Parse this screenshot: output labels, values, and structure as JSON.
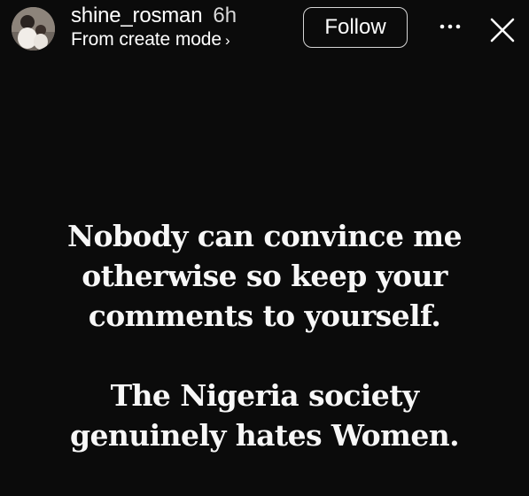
{
  "header": {
    "username": "shine_rosman",
    "time": "6h",
    "subtitle": "From create mode",
    "subtitle_chevron": "›",
    "follow_label": "Follow",
    "avatar_icon": "profile-photo",
    "more_icon": "more-horizontal-icon",
    "close_icon": "close-icon"
  },
  "story": {
    "background_color": "#0b0b0b",
    "text_color": "#f7f7f7",
    "paragraphs": [
      {
        "lines": [
          "Nobody can convince me",
          "otherwise so keep your",
          "comments to yourself."
        ]
      },
      {
        "lines": [
          "The Nigeria society",
          "genuinely hates Women."
        ]
      }
    ]
  }
}
